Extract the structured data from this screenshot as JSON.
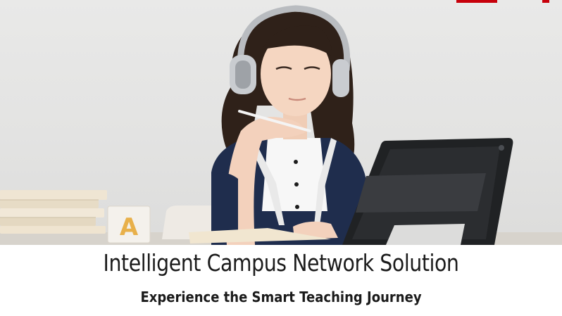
{
  "hero": {
    "block_letter": "A"
  },
  "caption": {
    "title": "Intelligent Campus Network Solution",
    "subtitle": "Experience the Smart Teaching Journey"
  },
  "colors": {
    "background": "#e6e6e5",
    "brand_red": "#c7000b",
    "text": "#1b1b1b",
    "uniform_navy": "#1f2d4d"
  }
}
